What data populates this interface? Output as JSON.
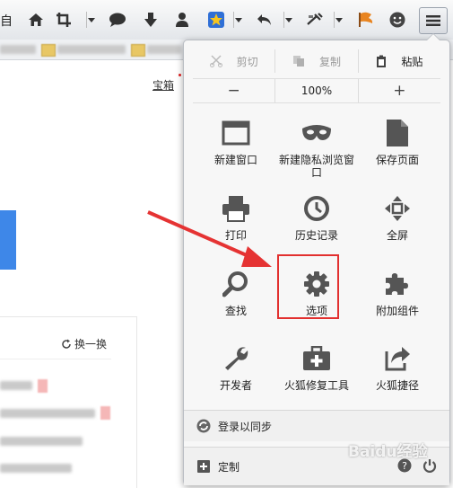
{
  "toolbar": {
    "left_char": "自",
    "icons": [
      "home-icon",
      "crop-icon",
      "chat-icon",
      "download-icon",
      "person-icon",
      "star-badge-icon",
      "undo-icon",
      "tools-icon",
      "flag-icon",
      "smiley-icon"
    ]
  },
  "page": {
    "link_text": "宝箱",
    "refresh_text": "换一换"
  },
  "panel": {
    "edit": {
      "cut": "剪切",
      "copy": "复制",
      "paste": "粘贴"
    },
    "zoom": {
      "minus": "−",
      "level": "100%",
      "plus": "+"
    },
    "items": [
      {
        "label": "新建窗口",
        "icon": "window-icon"
      },
      {
        "label": "新建隐私浏览窗口",
        "icon": "mask-icon"
      },
      {
        "label": "保存页面",
        "icon": "page-icon"
      },
      {
        "label": "打印",
        "icon": "printer-icon"
      },
      {
        "label": "历史记录",
        "icon": "clock-icon"
      },
      {
        "label": "全屏",
        "icon": "fullscreen-icon"
      },
      {
        "label": "查找",
        "icon": "magnifier-icon"
      },
      {
        "label": "选项",
        "icon": "gear-icon"
      },
      {
        "label": "附加组件",
        "icon": "puzzle-icon"
      },
      {
        "label": "开发者",
        "icon": "wrench-icon"
      },
      {
        "label": "火狐修复工具",
        "icon": "toolbox-icon"
      },
      {
        "label": "火狐捷径",
        "icon": "share-icon"
      }
    ],
    "sync_label": "登录以同步",
    "customize_label": "定制"
  },
  "watermark": "Baidu经验",
  "colors": {
    "highlight": "#e2302f",
    "arrow": "#e53333",
    "blue_button": "#3e87e8"
  }
}
